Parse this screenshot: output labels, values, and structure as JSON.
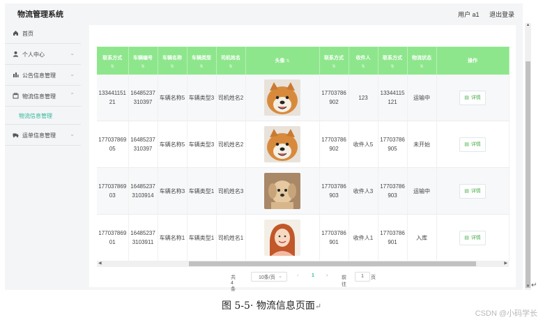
{
  "header": {
    "app_title": "物流管理系统",
    "user_label": "用户 a1",
    "logout_label": "退出登录"
  },
  "sidebar": {
    "items": [
      {
        "icon": "home-icon",
        "label": "首页",
        "chevron": ""
      },
      {
        "icon": "user-icon",
        "label": "个人中心",
        "chevron": "⌄"
      },
      {
        "icon": "chart-icon",
        "label": "公告信息管理",
        "chevron": "⌄"
      },
      {
        "icon": "box-icon",
        "label": "物流信息管理",
        "chevron": "⌃"
      },
      {
        "icon": "truck-icon",
        "label": "运单信息管理",
        "chevron": "⌄"
      }
    ],
    "active_sub": "物流信息管理"
  },
  "table": {
    "columns": [
      "联系方式",
      "车辆编号",
      "车辆名称",
      "车辆类型",
      "司机姓名",
      "头像",
      "联系方式",
      "收件人",
      "联系方式",
      "物流状态",
      "操作"
    ],
    "sort_glyph": "⇅",
    "rows": [
      {
        "c1": "13344115121",
        "c2": "16485237310397",
        "c3": "车辆名称5",
        "c4": "车辆类型3",
        "c5": "司机姓名2",
        "avatar": "dog-1",
        "c7": "17703786902",
        "c8": "123",
        "c9": "13344115121",
        "c10": "运输中",
        "action": "详情"
      },
      {
        "c1": "17703786905",
        "c2": "16485237310397",
        "c3": "车辆名称5",
        "c4": "车辆类型3",
        "c5": "司机姓名2",
        "avatar": "dog-1",
        "c7": "17703786902",
        "c8": "收件人5",
        "c9": "17703786905",
        "c10": "未开始",
        "action": "详情"
      },
      {
        "c1": "17703786903",
        "c2": "164852373103914",
        "c3": "车辆名称3",
        "c4": "车辆类型1",
        "c5": "司机姓名3",
        "avatar": "dog-2",
        "c7": "17703786903",
        "c8": "收件人3",
        "c9": "17703786903",
        "c10": "运输中",
        "action": "详情"
      },
      {
        "c1": "17703786901",
        "c2": "164852373103911",
        "c3": "车辆名称1",
        "c4": "车辆类型1",
        "c5": "司机姓名1",
        "avatar": "woman",
        "c7": "17703786901",
        "c8": "收件人1",
        "c9": "17703786901",
        "c10": "入库",
        "action": "详情"
      }
    ]
  },
  "pagination": {
    "total": "共 4 条",
    "page_size": "10条/页",
    "prev": "‹",
    "current": "1",
    "next": "›",
    "goto_label": "前往",
    "goto_value": "1",
    "goto_unit": "页"
  },
  "caption": {
    "text": "图 5-5· 物流信息页面",
    "mark": "↵"
  },
  "right_mark": "↵",
  "watermark": "CSDN @小码学长",
  "colors": {
    "header_green": "#8ee68c",
    "accent": "#2fb89a"
  }
}
